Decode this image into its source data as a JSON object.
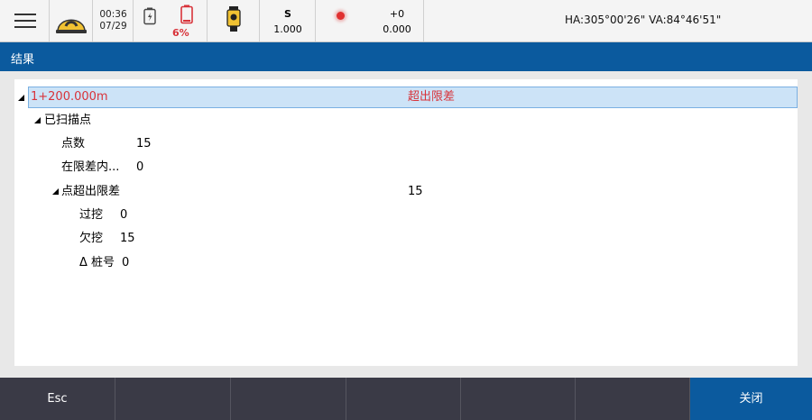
{
  "status_bar": {
    "menu_icon": "hamburger-menu-icon",
    "helmet_icon": "helmet-icon",
    "time": "00:36",
    "date": "07/29",
    "controller_battery_icon": "battery-low-icon",
    "instrument_battery_icon": "battery-icon",
    "instrument_battery_pct": "6%",
    "instrument_icon": "total-station-icon",
    "target_label": "S",
    "target_value": "1.000",
    "laser_icon": "laser-dot-icon",
    "laser_offset": "+0",
    "laser_value": "0.000",
    "angles": "HA:305°00'26\"  VA:84°46'51\""
  },
  "title": "结果",
  "tree": {
    "station": "1+200.000m",
    "station_status": "超出限差",
    "scanned_points_label": "已扫描点",
    "point_count_label": "点数",
    "point_count_value": "15",
    "within_tolerance_label": "在限差内...",
    "within_tolerance_value": "0",
    "out_of_tolerance_label": "点超出限差",
    "out_of_tolerance_value": "15",
    "overbreak_label": "过挖",
    "overbreak_value": "0",
    "underbreak_label": "欠挖",
    "underbreak_value": "15",
    "delta_station_label": "Δ 桩号",
    "delta_station_value": "0"
  },
  "bottom_bar": {
    "esc_label": "Esc",
    "close_label": "关闭"
  },
  "colors": {
    "accent": "#0b5a9e",
    "alert": "#d8333a",
    "selection": "#cce3f7",
    "bottom_bar": "#3a3a46"
  }
}
